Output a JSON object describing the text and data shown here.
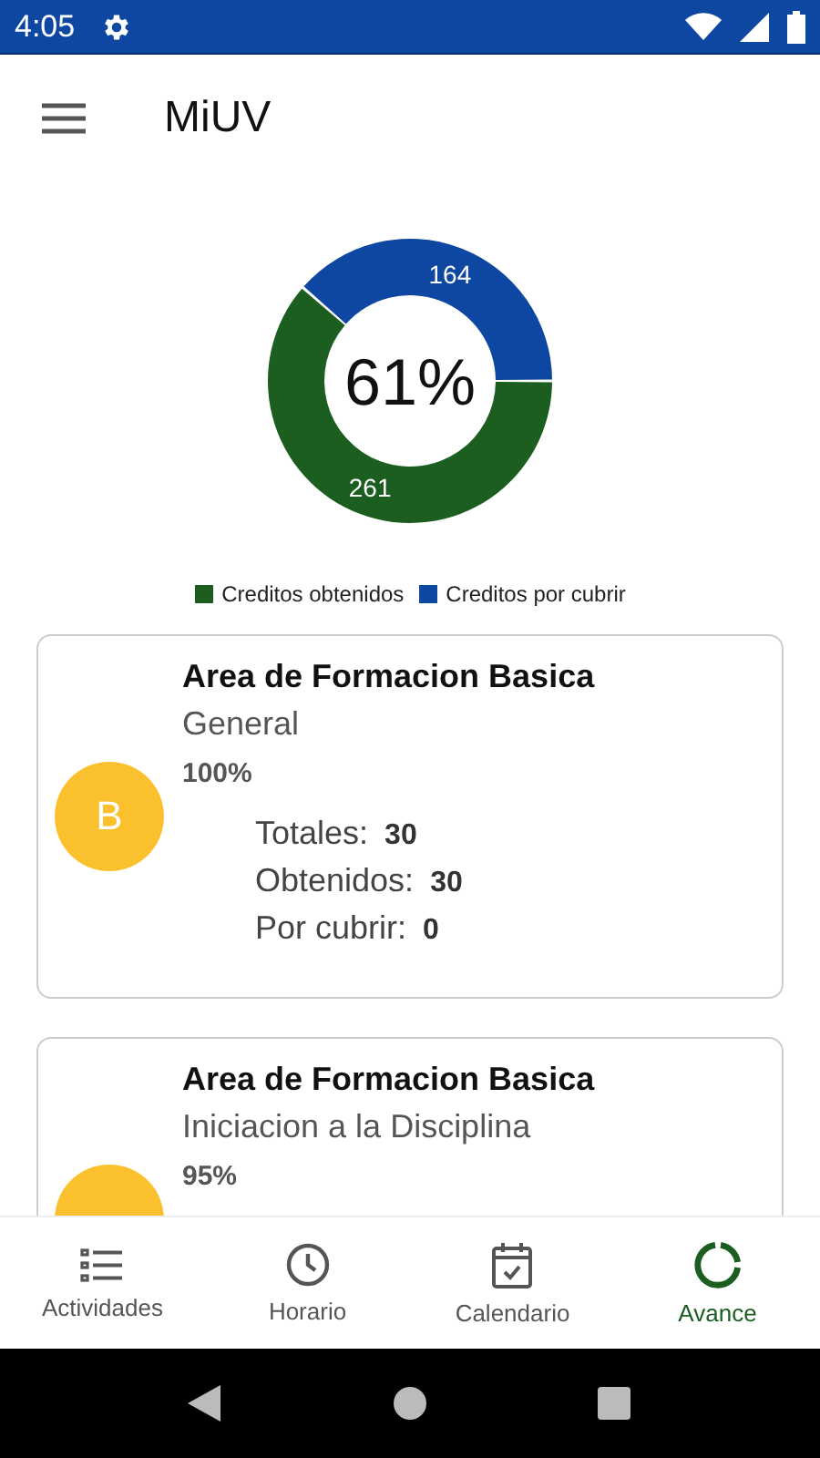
{
  "status_bar": {
    "time": "4:05"
  },
  "app_bar": {
    "title": "MiUV"
  },
  "progress": {
    "center_label": "61%",
    "chart_data": {
      "type": "donut",
      "categories": [
        "Creditos obtenidos",
        "Creditos por cubrir"
      ],
      "values": [
        261,
        164
      ],
      "colors": [
        "#1b5e20",
        "#0d47a1"
      ],
      "data_labels": true
    }
  },
  "cards": [
    {
      "title": "Area de Formacion Basica",
      "subtitle": "General",
      "percent": "100%",
      "badge": "B",
      "stats": [
        {
          "label": "Totales:",
          "value": "30"
        },
        {
          "label": "Obtenidos:",
          "value": "30"
        },
        {
          "label": "Por cubrir:",
          "value": "0"
        }
      ]
    },
    {
      "title": "Area de Formacion Basica",
      "subtitle": "Iniciacion a la Disciplina",
      "percent": "95%"
    }
  ],
  "bottom_nav": [
    {
      "label": "Actividades",
      "kind": "list",
      "selected": false
    },
    {
      "label": "Horario",
      "kind": "clock",
      "selected": false
    },
    {
      "label": "Calendario",
      "kind": "calendar",
      "selected": false
    },
    {
      "label": "Avance",
      "kind": "progress",
      "selected": true
    }
  ]
}
